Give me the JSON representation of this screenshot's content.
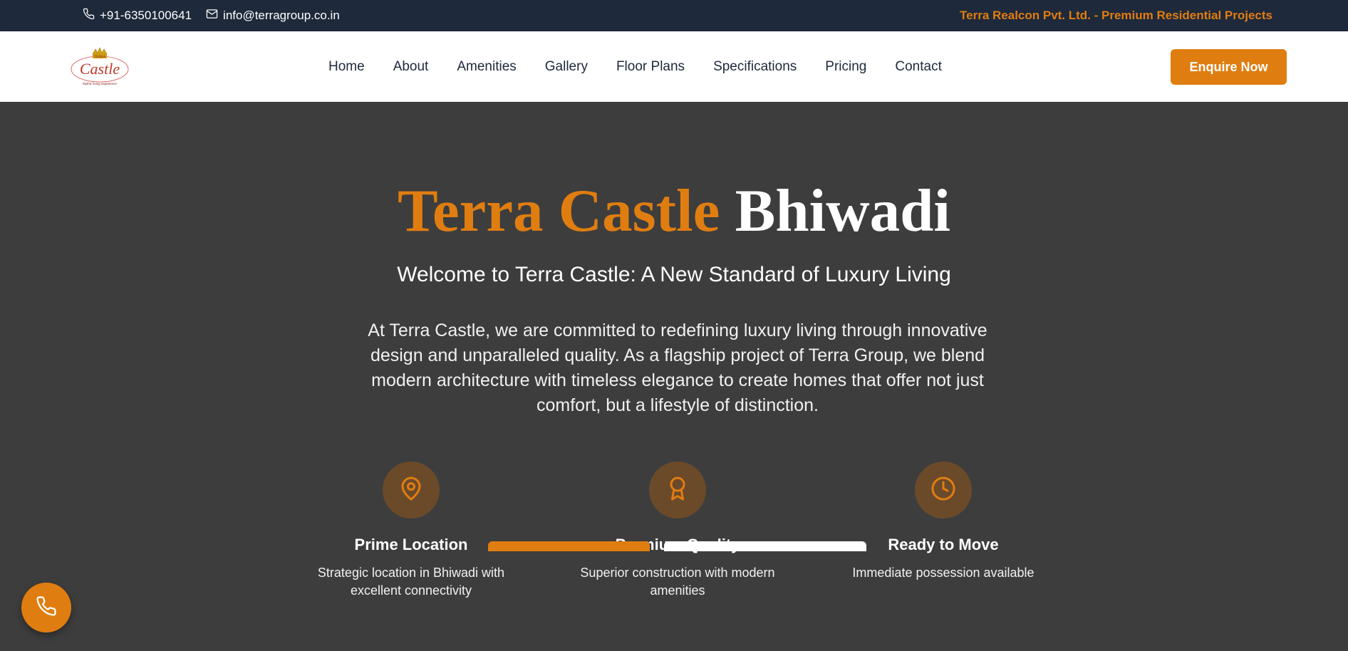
{
  "topbar": {
    "phone": "+91-6350100641",
    "email": "info@terragroup.co.in",
    "tagline": "Terra Realcon Pvt. Ltd. - Premium Residential Projects"
  },
  "nav": {
    "logo_text": "Castle",
    "logo_tag": "Terra",
    "logo_subtext": "Mythic living experience",
    "items": [
      "Home",
      "About",
      "Amenities",
      "Gallery",
      "Floor Plans",
      "Specifications",
      "Pricing",
      "Contact"
    ],
    "cta": "Enquire Now"
  },
  "hero": {
    "title_part1": "Terra Castle",
    "title_part2": "Bhiwadi",
    "subtitle": "Welcome to Terra Castle: A New Standard of Luxury Living",
    "description": "At Terra Castle, we are committed to redefining luxury living through innovative design and unparalleled quality. As a flagship project of Terra Group, we blend modern architecture with timeless elegance to create homes that offer not just comfort, but a lifestyle of distinction.",
    "features": [
      {
        "icon": "map-pin-icon",
        "title": "Prime Location",
        "text": "Strategic location in Bhiwadi with excellent connectivity"
      },
      {
        "icon": "award-icon",
        "title": "Premium Quality",
        "text": "Superior construction with modern amenities"
      },
      {
        "icon": "clock-icon",
        "title": "Ready to Move",
        "text": "Immediate possession available"
      }
    ]
  },
  "colors": {
    "accent": "#e07d10",
    "topbar_bg": "#1e293b",
    "hero_bg": "#3d3d3d"
  }
}
